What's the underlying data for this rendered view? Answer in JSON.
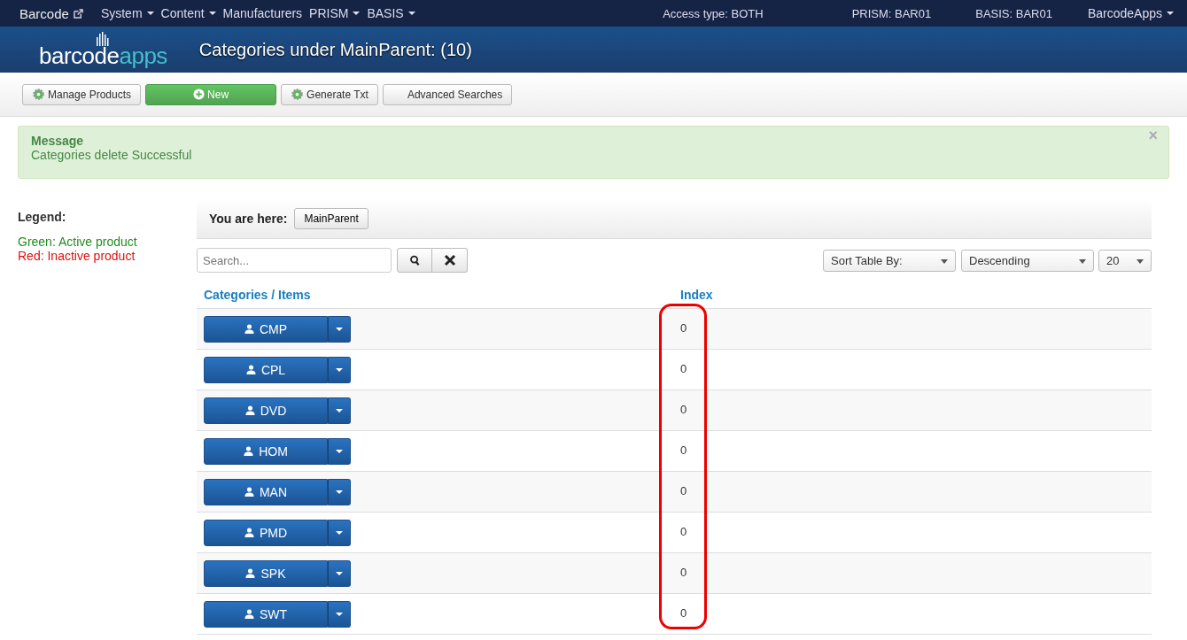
{
  "navbar": {
    "brand": "Barcode",
    "menus": [
      {
        "label": "System",
        "dropdown": true
      },
      {
        "label": "Content",
        "dropdown": true
      },
      {
        "label": "Manufacturers",
        "dropdown": false
      },
      {
        "label": "PRISM",
        "dropdown": true
      },
      {
        "label": "BASIS",
        "dropdown": true
      }
    ],
    "info": [
      "Access type: BOTH",
      "PRISM: BAR01",
      "BASIS: BAR01"
    ],
    "user": "BarcodeApps"
  },
  "header": {
    "logo": {
      "word": "barcode",
      "accent": "apps"
    },
    "title": "Categories under MainParent: (10)"
  },
  "toolbar": [
    {
      "label": "Manage Products",
      "kind": "gear"
    },
    {
      "label": "New",
      "kind": "primary"
    },
    {
      "label": "Generate Txt",
      "kind": "gear"
    },
    {
      "label": "Advanced Searches",
      "kind": "plain"
    }
  ],
  "alert": {
    "title": "Message",
    "text": "Categories delete Successful",
    "close": "×"
  },
  "legend": {
    "title": "Legend:",
    "items": [
      {
        "text": "Green: Active product",
        "color": "#228b22"
      },
      {
        "text": "Red: Inactive product",
        "color": "#dd1111"
      }
    ]
  },
  "breadcrumb": {
    "label": "You are here:",
    "items": [
      "MainParent"
    ]
  },
  "search": {
    "placeholder": "Search..."
  },
  "sort": {
    "field": "Sort Table By:",
    "order": "Descending",
    "page_size": "20"
  },
  "table": {
    "columns": [
      "Categories / Items",
      "Index"
    ],
    "rows": [
      {
        "name": "CMP",
        "index": "0"
      },
      {
        "name": "CPL",
        "index": "0"
      },
      {
        "name": "DVD",
        "index": "0"
      },
      {
        "name": "HOM",
        "index": "0"
      },
      {
        "name": "MAN",
        "index": "0"
      },
      {
        "name": "PMD",
        "index": "0"
      },
      {
        "name": "SPK",
        "index": "0"
      },
      {
        "name": "SWT",
        "index": "0"
      }
    ]
  }
}
